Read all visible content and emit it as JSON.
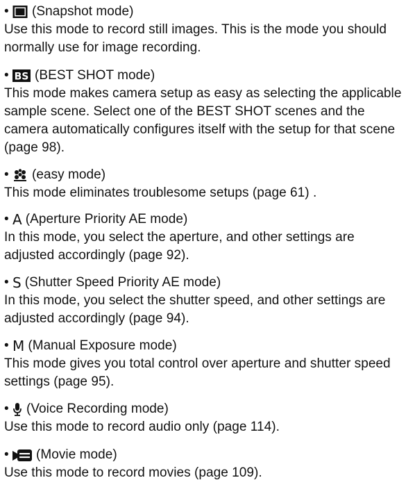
{
  "modes": [
    {
      "icon": "snapshot-icon",
      "label": "(Snapshot mode)",
      "desc": "Use this mode to record still images. This is the mode you should normally use for image recording."
    },
    {
      "icon": "best-shot-icon",
      "icon_text": "BS",
      "label": "(BEST SHOT mode)",
      "desc": "This mode makes camera setup as easy as selecting the applicable sample scene. Select one of the BEST SHOT scenes and the camera automatically configures itself with the setup for that scene (page 98)."
    },
    {
      "icon": "easy-mode-icon",
      "label": "(easy mode)",
      "desc": "This mode eliminates troublesome setups (page 61) ."
    },
    {
      "icon": "aperture-priority-icon",
      "icon_text": "A",
      "label": "(Aperture Priority AE mode)",
      "desc": "In this mode, you select the aperture, and other settings are adjusted accordingly (page 92)."
    },
    {
      "icon": "shutter-speed-priority-icon",
      "icon_text": "S",
      "label": "(Shutter Speed Priority AE mode)",
      "desc": "In this mode, you select the shutter speed, and other settings are adjusted accordingly (page 94)."
    },
    {
      "icon": "manual-exposure-icon",
      "icon_text": "M",
      "label": "(Manual Exposure mode)",
      "desc": "This mode gives you total control over aperture and shutter speed settings (page 95)."
    },
    {
      "icon": "microphone-icon",
      "label": "(Voice Recording mode)",
      "desc": "Use this mode to record audio only (page 114)."
    },
    {
      "icon": "movie-camera-icon",
      "label": "(Movie mode)",
      "desc": "Use this mode to record movies (page 109)."
    }
  ]
}
